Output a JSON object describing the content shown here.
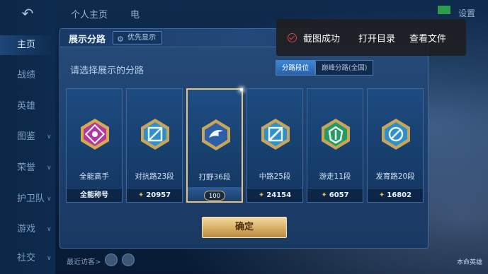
{
  "topbar": {
    "tabs": [
      "个人主页",
      "电"
    ],
    "settings_label": "设置"
  },
  "leftnav": {
    "back_icon": "back-arrow-icon",
    "items": [
      {
        "label": "主页",
        "active": true
      },
      {
        "label": "战绩"
      },
      {
        "label": "英雄"
      },
      {
        "label": "图鉴",
        "chevron": true
      },
      {
        "label": "荣誉",
        "chevron": true
      },
      {
        "label": "护卫队",
        "chevron": true
      },
      {
        "label": "游戏",
        "chevron": true
      },
      {
        "label": "社交",
        "chevron": true
      }
    ]
  },
  "panel": {
    "title": "展示分路",
    "priority_label": "优先显示",
    "subtitle": "请选择展示的分路",
    "toggle": {
      "options": [
        "分路段位",
        "巅峰分路(全国)"
      ],
      "selected": 0
    },
    "cards": [
      {
        "label": "全能高手",
        "footer": "全能称号",
        "type": "title",
        "color": "#c34fb8"
      },
      {
        "label": "对抗路23段",
        "score": "20957",
        "color": "#3fa6d6"
      },
      {
        "label": "打野36段",
        "rank_tag": "100",
        "selected": true,
        "color": "#4a8fd8"
      },
      {
        "label": "中路25段",
        "score": "24154",
        "color": "#3fa6d6"
      },
      {
        "label": "游走11段",
        "score": "6057",
        "color": "#2ea970"
      },
      {
        "label": "发育路20段",
        "score": "16802",
        "color": "#3fa6d6"
      }
    ],
    "confirm_label": "确定"
  },
  "toast": {
    "message": "截图成功",
    "open_dir": "打开目录",
    "view_file": "查看文件"
  },
  "bottom": {
    "visitor_label": "最近访客>",
    "hero_label": "本命英雄"
  },
  "colors": {
    "accent_gold": "#d7ad62",
    "panel_blue": "#1f4170",
    "toast_check": "#e0453c"
  }
}
